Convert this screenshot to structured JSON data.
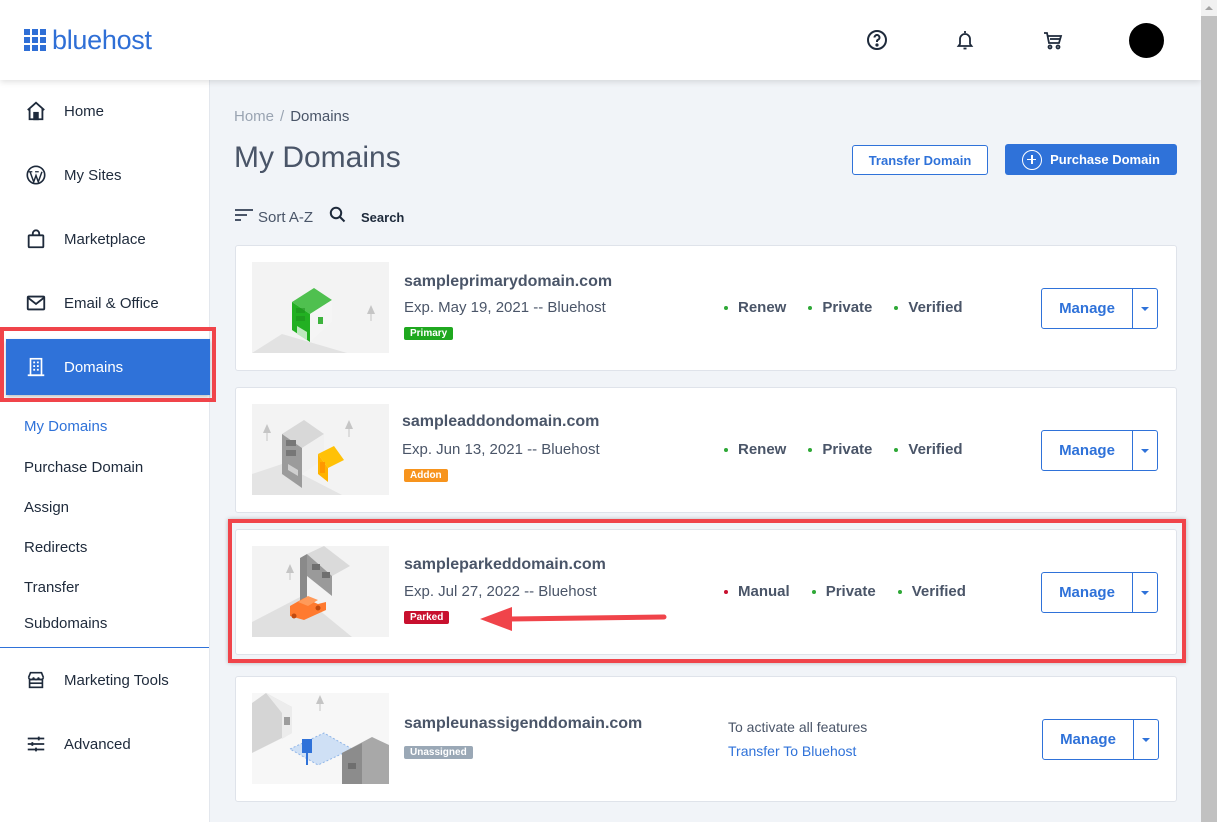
{
  "header": {
    "logo_text": "bluehost",
    "icons": [
      "help-icon",
      "bell-icon",
      "cart-icon",
      "avatar"
    ]
  },
  "sidebar": {
    "items": [
      {
        "label": "Home",
        "icon": "home-icon"
      },
      {
        "label": "My Sites",
        "icon": "wordpress-icon"
      },
      {
        "label": "Marketplace",
        "icon": "shopping-bag-icon"
      },
      {
        "label": "Email & Office",
        "icon": "envelope-icon"
      },
      {
        "label": "Domains",
        "icon": "building-icon",
        "active": true
      },
      {
        "label": "Marketing Tools",
        "icon": "storefront-icon"
      },
      {
        "label": "Advanced",
        "icon": "sliders-icon"
      }
    ],
    "sub_items": [
      {
        "label": "My Domains",
        "current": true
      },
      {
        "label": "Purchase Domain"
      },
      {
        "label": "Assign"
      },
      {
        "label": "Redirects"
      },
      {
        "label": "Transfer"
      },
      {
        "label": "Subdomains"
      }
    ]
  },
  "breadcrumb": {
    "home": "Home",
    "separator": "/",
    "current": "Domains"
  },
  "page": {
    "title": "My Domains",
    "transfer_button": "Transfer Domain",
    "purchase_button": "Purchase Domain",
    "sort_label": "Sort A-Z",
    "search_label": "Search"
  },
  "domains": [
    {
      "name": "sampleprimarydomain.com",
      "expiry": "Exp. May 19, 2021 -- Bluehost",
      "badge": "Primary",
      "badge_color": "#1fa81f",
      "statuses": [
        {
          "label": "Renew",
          "color": "#2ea836"
        },
        {
          "label": "Private",
          "color": "#2ea836"
        },
        {
          "label": "Verified",
          "color": "#2ea836"
        }
      ],
      "manage_label": "Manage"
    },
    {
      "name": "sampleaddondomain.com",
      "expiry": "Exp. Jun 13, 2021 -- Bluehost",
      "badge": "Addon",
      "badge_color": "#f7941d",
      "statuses": [
        {
          "label": "Renew",
          "color": "#2ea836"
        },
        {
          "label": "Private",
          "color": "#2ea836"
        },
        {
          "label": "Verified",
          "color": "#2ea836"
        }
      ],
      "manage_label": "Manage"
    },
    {
      "name": "sampleparkeddomain.com",
      "expiry": "Exp. Jul 27, 2022 -- Bluehost",
      "badge": "Parked",
      "badge_color": "#c8102e",
      "statuses": [
        {
          "label": "Manual",
          "color": "#c8102e"
        },
        {
          "label": "Private",
          "color": "#2ea836"
        },
        {
          "label": "Verified",
          "color": "#2ea836"
        }
      ],
      "manage_label": "Manage"
    },
    {
      "name": "sampleunassigenddomain.com",
      "badge": "Unassigned",
      "badge_color": "#9aa8b6",
      "activate_text": "To activate all features",
      "transfer_link": "Transfer To Bluehost",
      "manage_label": "Manage"
    }
  ],
  "colors": {
    "brand": "#2f72d9",
    "highlight": "#f0444a"
  }
}
